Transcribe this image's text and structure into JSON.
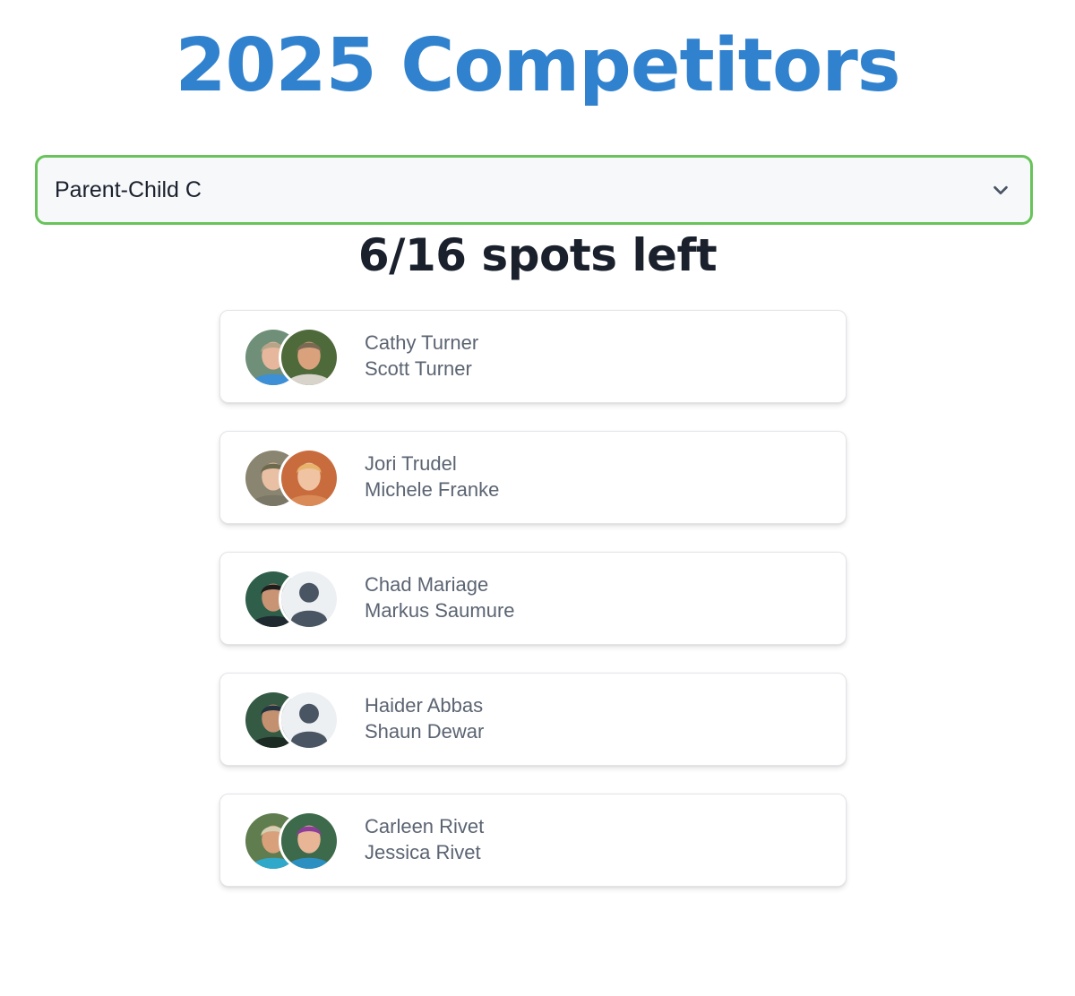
{
  "header": {
    "title": "2025 Competitors"
  },
  "division_select": {
    "value": "Parent-Child C",
    "icon": "chevron-down-icon"
  },
  "spots": {
    "text": "6/16 spots left"
  },
  "teams": [
    {
      "member1": "Cathy Turner",
      "member2": "Scott Turner",
      "avatar1": {
        "type": "photo",
        "bg": "#6f8f78",
        "skin": "#e6b79c",
        "hair": "#b7a58a",
        "shirt": "#3d8fd6"
      },
      "avatar2": {
        "type": "photo",
        "bg": "#4f6a3a",
        "skin": "#d9a27d",
        "hair": "#7a6a54",
        "shirt": "#d8d4cc"
      }
    },
    {
      "member1": "Jori Trudel",
      "member2": "Michele Franke",
      "avatar1": {
        "type": "photo",
        "bg": "#8a8570",
        "skin": "#e9c0a4",
        "hair": "#6d6a4e",
        "shirt": "#7b7766"
      },
      "avatar2": {
        "type": "photo",
        "bg": "#c96c3d",
        "skin": "#f0c3a3",
        "hair": "#e8b36b",
        "shirt": "#d98a57"
      }
    },
    {
      "member1": "Chad Mariage",
      "member2": "Markus Saumure",
      "avatar1": {
        "type": "photo",
        "bg": "#2f5f4a",
        "skin": "#c99473",
        "hair": "#1e1e1e",
        "shirt": "#1f2a30"
      },
      "avatar2": {
        "type": "placeholder",
        "bg": "#edf0f3",
        "fg": "#4a5563"
      }
    },
    {
      "member1": "Haider Abbas",
      "member2": "Shaun Dewar",
      "avatar1": {
        "type": "photo",
        "bg": "#355a44",
        "skin": "#c39070",
        "hair": "#233340",
        "shirt": "#1c2b24"
      },
      "avatar2": {
        "type": "placeholder",
        "bg": "#edf0f3",
        "fg": "#4a5563"
      }
    },
    {
      "member1": "Carleen Rivet",
      "member2": "Jessica Rivet",
      "avatar1": {
        "type": "photo",
        "bg": "#5f7d4f",
        "skin": "#d9a07c",
        "hair": "#d6cfb4",
        "shirt": "#2fa8c9"
      },
      "avatar2": {
        "type": "photo",
        "bg": "#3d6a4a",
        "skin": "#e8b597",
        "hair": "#8c3e9a",
        "shirt": "#2b8fc2"
      }
    }
  ]
}
